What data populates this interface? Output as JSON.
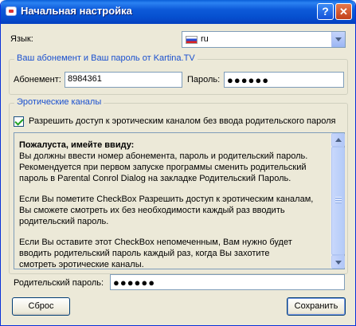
{
  "window": {
    "title": "Начальная настройка",
    "help_glyph": "?",
    "close_glyph": "✕"
  },
  "language": {
    "label": "Язык:",
    "selected": "ru",
    "flag": "flag-ru"
  },
  "account_group": {
    "title": "Ваш абонемент и Ваш пароль от Kartina.TV",
    "subscription_label": "Абонемент:",
    "subscription_value": "8984361",
    "password_label": "Пароль:",
    "password_value": "●●●●●●"
  },
  "erotic_group": {
    "title": "Эротические каналы",
    "checkbox_label": "Разрешить доступ к эротическим каналом без ввода родительского пароля",
    "checkbox_checked": true,
    "info_heading": "Пожалуста, имейте ввиду:",
    "info_p1": "Вы должны ввести номер абонемента, пароль и родительский пароль.\nРекомендуется при первом запуске программы сменить родительский\nпароль в Parental Conrol Dialog на закладке Родительский Пароль.",
    "info_p2": "Если Вы пометите CheckBox Разрешить доступ к эротическим каналам,\nВы сможете смотреть их без необходимости каждый раз вводить\nродительский пароль.",
    "info_p3": "Если Вы оставите этот CheckBox непомеченным, Вам нужно будет\nвводить родительский пароль каждый раз, когда Вы захотите\nсмотреть эротические каналы."
  },
  "parental": {
    "label": "Родительский пароль:",
    "value": "●●●●●●"
  },
  "buttons": {
    "reset": "Сброс",
    "save": "Сохранить"
  }
}
